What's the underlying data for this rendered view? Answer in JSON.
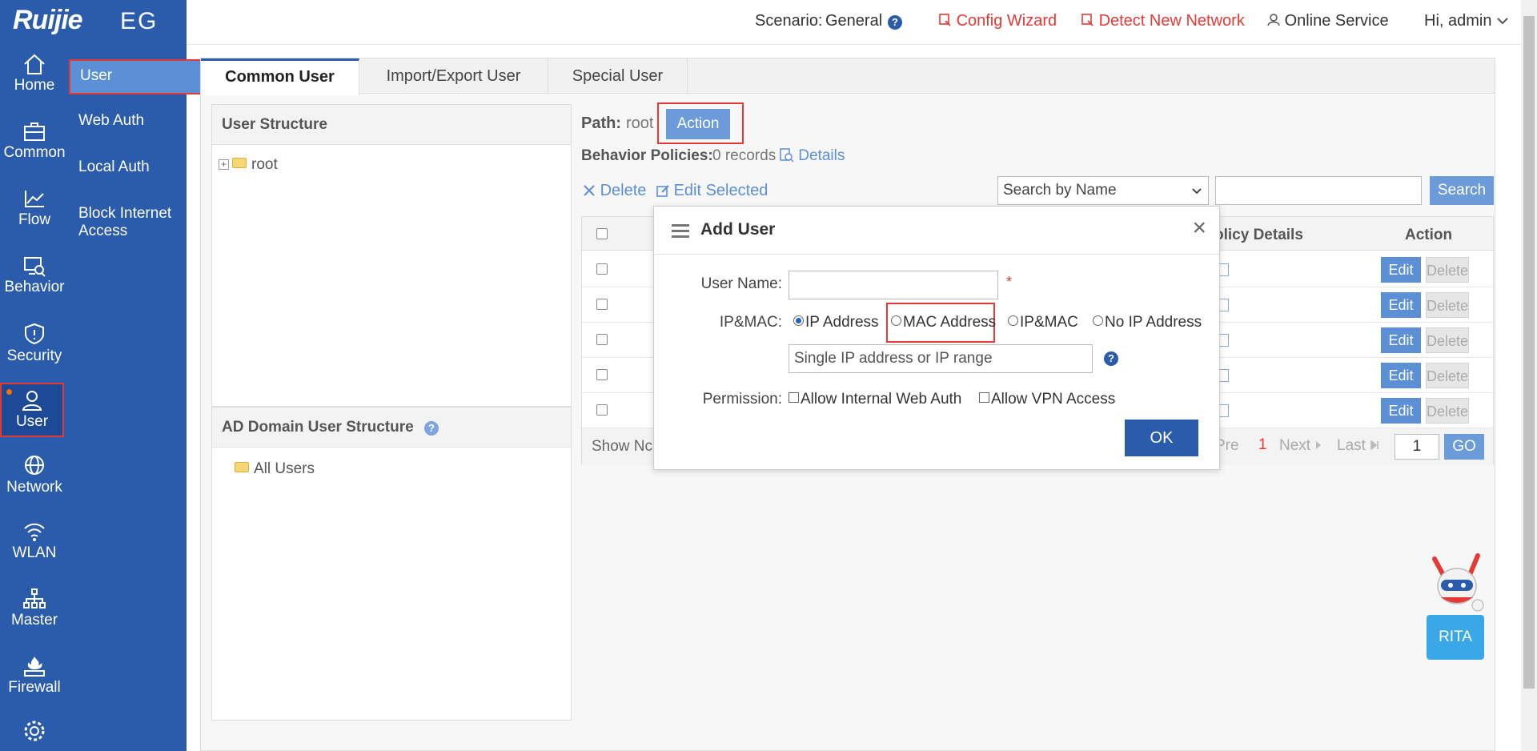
{
  "brand": {
    "name": "Ruijie",
    "model": "EG"
  },
  "topbar": {
    "scenario_label": "Scenario:",
    "scenario_value": "General",
    "config_wizard": "Config Wizard",
    "detect_new_network": "Detect New Network",
    "online_service": "Online Service",
    "greeting": "Hi, admin"
  },
  "nav": {
    "items": [
      {
        "label": "Home"
      },
      {
        "label": "Common"
      },
      {
        "label": "Flow"
      },
      {
        "label": "Behavior"
      },
      {
        "label": "Security"
      },
      {
        "label": "User"
      },
      {
        "label": "Network"
      },
      {
        "label": "WLAN"
      },
      {
        "label": "Master"
      },
      {
        "label": "Firewall"
      }
    ]
  },
  "subnav": {
    "items": [
      {
        "label": "User"
      },
      {
        "label": "Web Auth"
      },
      {
        "label": "Local Auth"
      },
      {
        "label": "Block Internet Access"
      }
    ]
  },
  "tabs": [
    {
      "label": "Common User"
    },
    {
      "label": "Import/Export User"
    },
    {
      "label": "Special User"
    }
  ],
  "user_structure": {
    "title": "User Structure",
    "root": "root"
  },
  "ad_structure": {
    "title": "AD Domain User Structure",
    "all_users": "All Users"
  },
  "main": {
    "path_label": "Path:",
    "path_value": "root",
    "action_button": "Action",
    "behavior_label": "Behavior Policies:",
    "behavior_value": "0 records",
    "details_link": "Details",
    "delete_link": "Delete",
    "edit_selected_link": "Edit Selected",
    "search_select": "Search by Name",
    "search_button": "Search"
  },
  "grid": {
    "col_policy": "olicy Details",
    "col_action": "Action",
    "edit_label": "Edit",
    "delete_label": "Delete",
    "show_label": "Show Nc"
  },
  "pager": {
    "pre": "Pre",
    "current": "1",
    "next": "Next",
    "last": "Last",
    "page_input": "1",
    "go": "GO"
  },
  "modal": {
    "title": "Add User",
    "username_label": "User Name:",
    "required_mark": "*",
    "ipmac_label": "IP&MAC:",
    "options": [
      "IP Address",
      "MAC Address",
      "IP&MAC",
      "No IP Address"
    ],
    "selected_option": "IP Address",
    "ip_placeholder": "Single IP address or IP range",
    "permission_label": "Permission:",
    "perm_web_auth": "Allow Internal Web Auth",
    "perm_vpn": "Allow VPN Access",
    "ok_button": "OK"
  },
  "rita": {
    "label": "RITA"
  }
}
